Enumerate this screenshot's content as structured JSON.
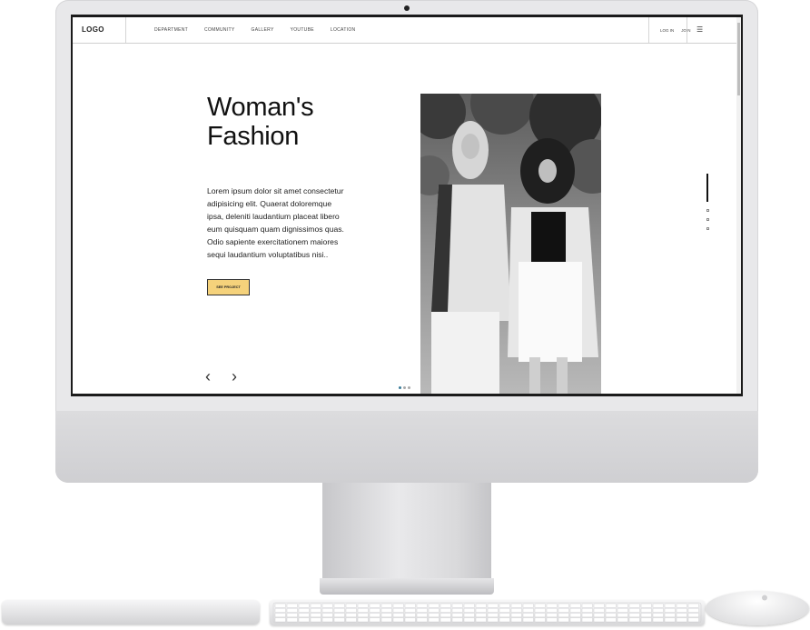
{
  "nav": {
    "logo": "LOGO",
    "links": [
      "DEPARTMENT",
      "COMMUNITY",
      "GALLERY",
      "YOUTUBE",
      "LOCATION"
    ],
    "login": "LOG IN",
    "join": "JOIN",
    "menu_icon": "hamburger-icon"
  },
  "hero": {
    "title": "Woman's\nFashion",
    "description": "Lorem ipsum dolor sit amet consectetur\nadipisicing elit. Quaerat doloremque\nipsa, deleniti laudantium placeat libero\neum quisquam quam dignissimos quas.\nOdio sapiente exercitationem maiores\nsequi laudantium voluptatibus nisi..",
    "cta_label": "SEE PROJECT",
    "prev_icon": "chevron-left-icon",
    "next_icon": "chevron-right-icon",
    "image_icon": "fashion-photo"
  },
  "colors": {
    "cta": "#f5d27b",
    "text": "#111111",
    "device": "#e8e8ea"
  }
}
